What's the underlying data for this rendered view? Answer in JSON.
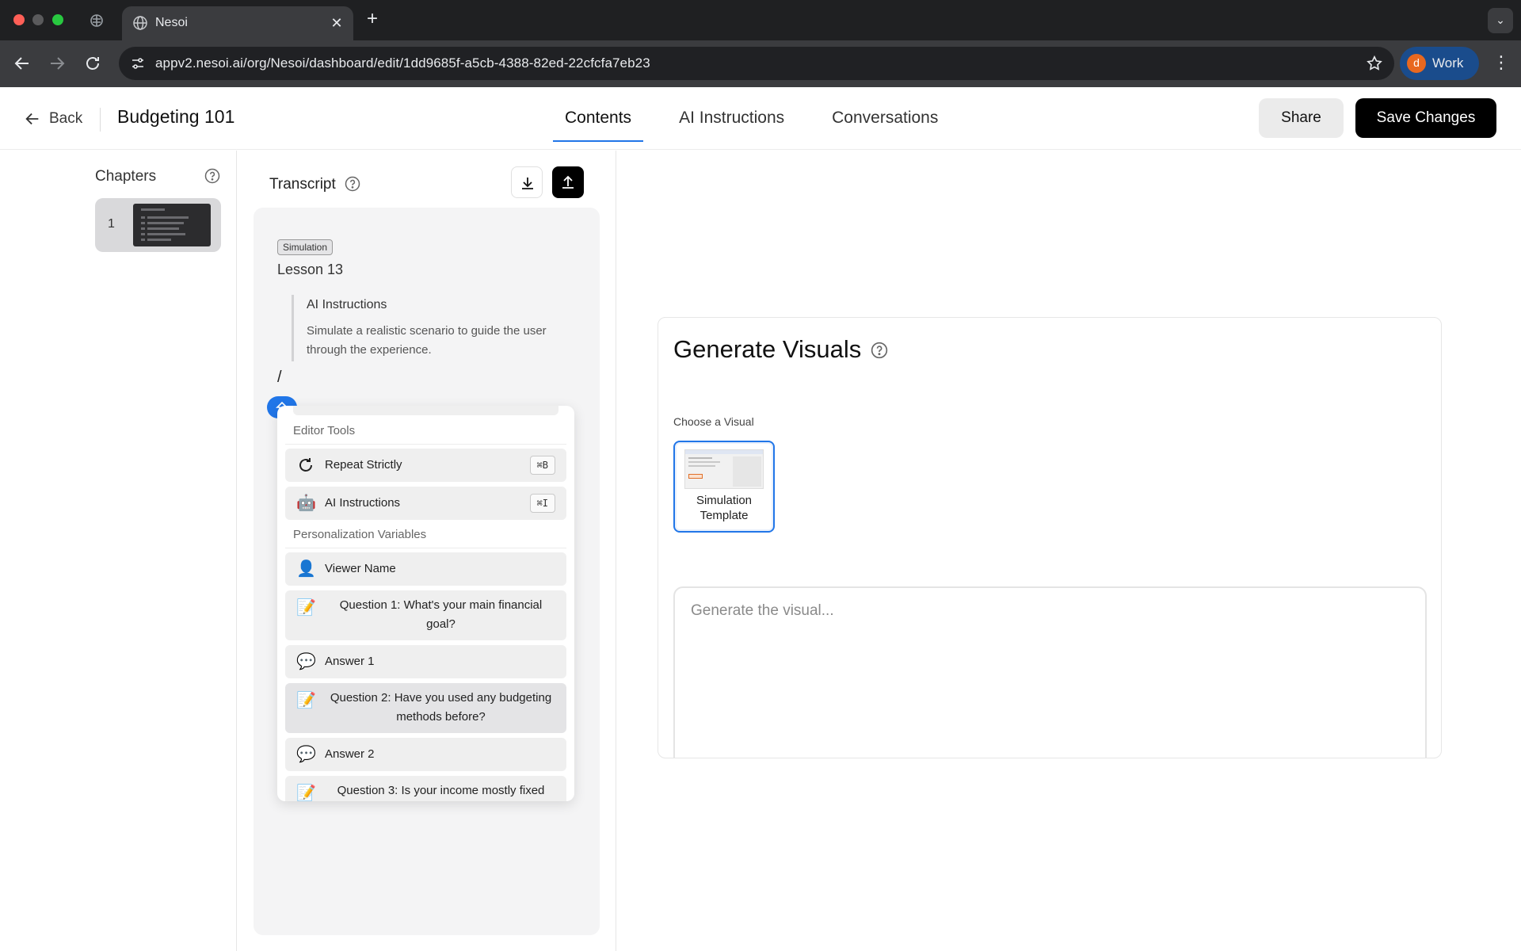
{
  "browser": {
    "tab_title": "Nesoi",
    "url": "appv2.nesoi.ai/org/Nesoi/dashboard/edit/1dd9685f-a5cb-4388-82ed-22cfcfa7eb23",
    "profile_initial": "d",
    "profile_label": "Work"
  },
  "header": {
    "back_label": "Back",
    "title": "Budgeting 101",
    "tabs": [
      {
        "label": "Contents",
        "active": true
      },
      {
        "label": "AI Instructions",
        "active": false
      },
      {
        "label": "Conversations",
        "active": false
      }
    ],
    "share_label": "Share",
    "save_label": "Save Changes"
  },
  "chapters": {
    "title": "Chapters",
    "items": [
      {
        "number": "1"
      }
    ]
  },
  "transcript": {
    "title": "Transcript",
    "badge": "Simulation",
    "lesson_title": "Lesson 13",
    "ai_instructions_title": "AI Instructions",
    "ai_instructions_text": "Simulate a realistic scenario to guide the user through the experience.",
    "cursor_text": "/"
  },
  "editor_popup": {
    "tools_section": "Editor Tools",
    "tools": [
      {
        "icon": "repeat-icon",
        "label": "Repeat Strictly",
        "shortcut": "⌘B"
      },
      {
        "icon": "robot-icon",
        "label": "AI Instructions",
        "shortcut": "⌘I"
      }
    ],
    "variables_section": "Personalization Variables",
    "variables": [
      {
        "icon": "person-icon",
        "label": "Viewer Name"
      },
      {
        "icon": "memo-icon",
        "label": "Question 1: What's your main financial goal?"
      },
      {
        "icon": "speech-bubble-icon",
        "label": "Answer 1"
      },
      {
        "icon": "memo-icon",
        "label": "Question 2: Have you used any budgeting methods before?"
      },
      {
        "icon": "speech-bubble-icon",
        "label": "Answer 2"
      },
      {
        "icon": "memo-icon",
        "label": "Question 3: Is your income mostly fixed"
      }
    ]
  },
  "visuals": {
    "title": "Generate Visuals",
    "choose_label": "Choose a Visual",
    "options": [
      {
        "label": "Simulation Template",
        "selected": true
      }
    ],
    "prompt_placeholder": "Generate the visual..."
  },
  "colors": {
    "accent": "#2176e8",
    "primary_button": "#000000",
    "profile_chip": "#1a4c8c"
  }
}
